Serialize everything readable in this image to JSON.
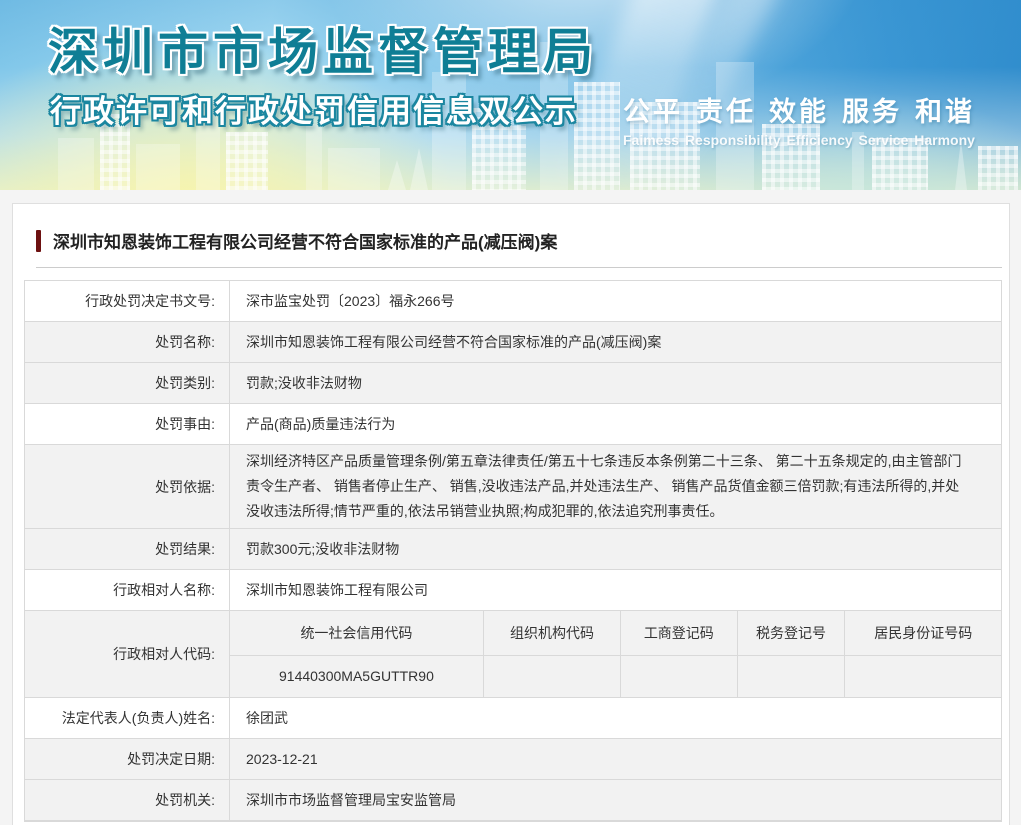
{
  "banner": {
    "title": "深圳市市场监督管理局",
    "subtitle": "行政许可和行政处罚信用信息双公示",
    "slogan_cn": [
      "公平",
      "责任",
      "效能",
      "服务",
      "和谐"
    ],
    "slogan_en": [
      "Faimess",
      "Responsibility",
      "Efficiency",
      "Service",
      "Harmony"
    ],
    "colors": {
      "title_fill": "#0f7e95",
      "subtitle_outline": "#1b86a0",
      "sky_blue": "#3b97d4",
      "bottom_yellow": "#f0f5cd"
    }
  },
  "article": {
    "title": "深圳市知恩装饰工程有限公司经营不符合国家标准的产品(减压阀)案",
    "accent_bar_color": "#6d1111"
  },
  "table": {
    "rows": [
      {
        "label": "行政处罚决定书文号:",
        "value": "深市监宝处罚〔2023〕福永266号"
      },
      {
        "label": "处罚名称:",
        "value": "深圳市知恩装饰工程有限公司经营不符合国家标准的产品(减压阀)案"
      },
      {
        "label": "处罚类别:",
        "value": "罚款;没收非法财物"
      },
      {
        "label": "处罚事由:",
        "value": "产品(商品)质量违法行为"
      },
      {
        "label": "处罚依据:",
        "value": "深圳经济特区产品质量管理条例/第五章法律责任/第五十七条违反本条例第二十三条、 第二十五条规定的,由主管部门责令生产者、 销售者停止生产、 销售,没收违法产品,并处违法生产、 销售产品货值金额三倍罚款;有违法所得的,并处没收违法所得;情节严重的,依法吊销营业执照;构成犯罪的,依法追究刑事责任。"
      },
      {
        "label": "处罚结果:",
        "value": "罚款300元;没收非法财物"
      },
      {
        "label": "行政相对人名称:",
        "value": "深圳市知恩装饰工程有限公司"
      },
      {
        "label": "行政相对人代码:",
        "value": ""
      },
      {
        "label": "法定代表人(负责人)姓名:",
        "value": "徐团武"
      },
      {
        "label": "处罚决定日期:",
        "value": "2023-12-21"
      },
      {
        "label": "处罚机关:",
        "value": "深圳市市场监督管理局宝安监管局"
      }
    ],
    "codes": {
      "headers": [
        "统一社会信用代码",
        "组织机构代码",
        "工商登记码",
        "税务登记号",
        "居民身份证号码"
      ],
      "values": [
        "91440300MA5GUTTR90",
        "",
        "",
        "",
        ""
      ]
    }
  }
}
